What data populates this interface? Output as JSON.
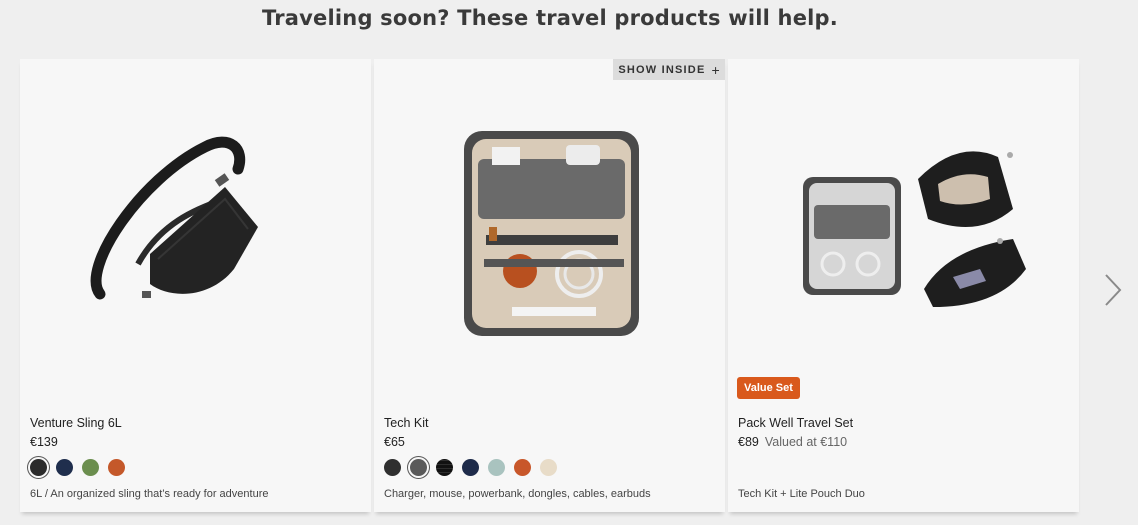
{
  "section": {
    "title": "Traveling soon? These travel products will help."
  },
  "products": [
    {
      "name": "Venture Sling 6L",
      "price": "€139",
      "description": "6L / An organized sling that’s ready for adventure",
      "image_icon": "venture-sling-image",
      "swatches": [
        {
          "color": "#2b2b2b",
          "selected": true
        },
        {
          "color": "#1f2e4d",
          "selected": false
        },
        {
          "color": "#6b8e4e",
          "selected": false
        },
        {
          "color": "#c4582a",
          "selected": false
        }
      ]
    },
    {
      "name": "Tech Kit",
      "price": "€65",
      "description": "Charger, mouse, powerbank, dongles, cables, earbuds",
      "image_icon": "tech-kit-image",
      "show_inside_label": "SHOW INSIDE",
      "show_inside_icon": "plus-icon",
      "swatches": [
        {
          "color": "#2f2f2f",
          "selected": false
        },
        {
          "color": "#5a5a5a",
          "selected": true
        },
        {
          "color": "#4a4a4a",
          "selected": false,
          "pattern": "grid"
        },
        {
          "color": "#1e2b4a",
          "selected": false
        },
        {
          "color": "#a9c3bf",
          "selected": false
        },
        {
          "color": "#c8572a",
          "selected": false
        },
        {
          "color": "#e8dcc8",
          "selected": false
        }
      ]
    },
    {
      "name": "Pack Well Travel Set",
      "price": "€89",
      "valued_at": "Valued at €110",
      "badge": "Value Set",
      "badge_color": "#d9591c",
      "description": "Tech Kit + Lite Pouch Duo",
      "image_icon": "pack-well-set-image"
    }
  ],
  "carousel": {
    "next_icon": "chevron-right-icon"
  }
}
